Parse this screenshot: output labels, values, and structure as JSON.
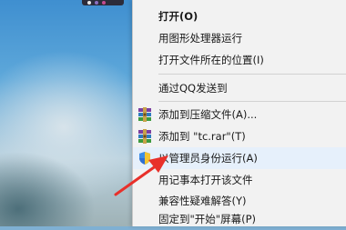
{
  "context_menu": {
    "items": [
      {
        "label": "打开(O)"
      },
      {
        "label": "用图形处理器运行"
      },
      {
        "label": "打开文件所在的位置(I)"
      },
      {
        "label": "通过QQ发送到"
      },
      {
        "label": "添加到压缩文件(A)...",
        "icon": "winrar-icon"
      },
      {
        "label": "添加到 \"tc.rar\"(T)",
        "icon": "winrar-icon"
      },
      {
        "label": "以管理员身份运行(A)",
        "icon": "uac-shield-icon"
      },
      {
        "label": "用记事本打开该文件"
      },
      {
        "label": "兼容性疑难解答(Y)"
      },
      {
        "label": "固定到\"开始\"屏幕(P)"
      }
    ]
  },
  "annotation": {
    "color": "#e8302a"
  }
}
